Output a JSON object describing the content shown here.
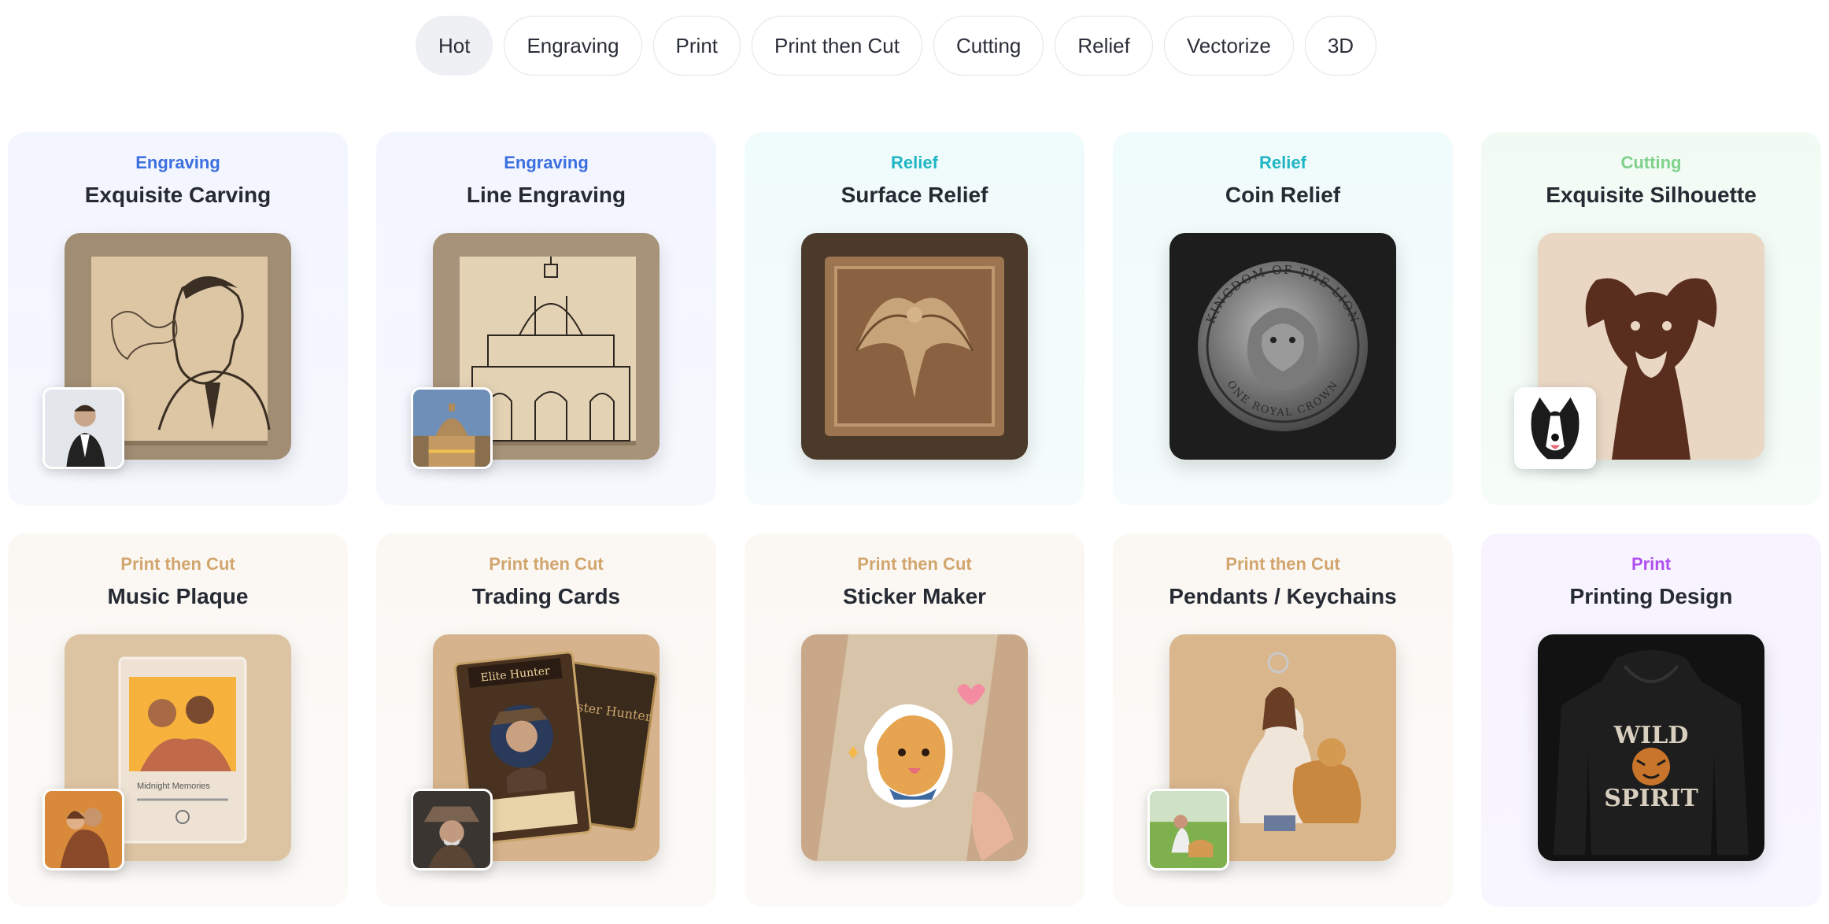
{
  "tabs": [
    "Hot",
    "Engraving",
    "Print",
    "Print then Cut",
    "Cutting",
    "Relief",
    "Vectorize",
    "3D"
  ],
  "active_tab": "Hot",
  "colors": {
    "engraving": "#3b6fe0",
    "relief": "#1fb6c4",
    "cutting": "#7fd18b",
    "print_then_cut": "#d2a56e",
    "print": "#b04ef0"
  },
  "cards": [
    {
      "category": "Engraving",
      "title": "Exquisite Carving",
      "image": "man-smoking-engraving",
      "mini": "man-portrait-photo"
    },
    {
      "category": "Engraving",
      "title": "Line Engraving",
      "image": "cathedral-line-engraving",
      "mini": "cathedral-photo"
    },
    {
      "category": "Relief",
      "title": "Surface Relief",
      "image": "eagle-wood-relief"
    },
    {
      "category": "Relief",
      "title": "Coin Relief",
      "image": "lion-coin-relief",
      "coin_top_text": "KINGDOM OF THE LION",
      "coin_bottom_text": "ONE ROYAL CROWN"
    },
    {
      "category": "Cutting",
      "title": "Exquisite Silhouette",
      "image": "dog-silhouette-cut",
      "mini": "border-collie-photo"
    },
    {
      "category": "Print then Cut",
      "title": "Music Plaque",
      "image": "acrylic-music-plaque",
      "mini": "couple-photo",
      "plaque_song": "Midnight Memories"
    },
    {
      "category": "Print then Cut",
      "title": "Trading Cards",
      "image": "cowboy-trading-cards",
      "mini": "cowboy-photo",
      "card_name": "Elite Hunter",
      "card_back": "Master Hunter"
    },
    {
      "category": "Print then Cut",
      "title": "Sticker Maker",
      "image": "golden-retriever-sticker"
    },
    {
      "category": "Print then Cut",
      "title": "Pendants / Keychains",
      "image": "woman-dog-keychain",
      "mini": "woman-dog-photo"
    },
    {
      "category": "Print",
      "title": "Printing Design",
      "image": "tiger-hoodie-print",
      "hoodie_text_1": "WILD",
      "hoodie_text_2": "SPIRIT"
    }
  ]
}
